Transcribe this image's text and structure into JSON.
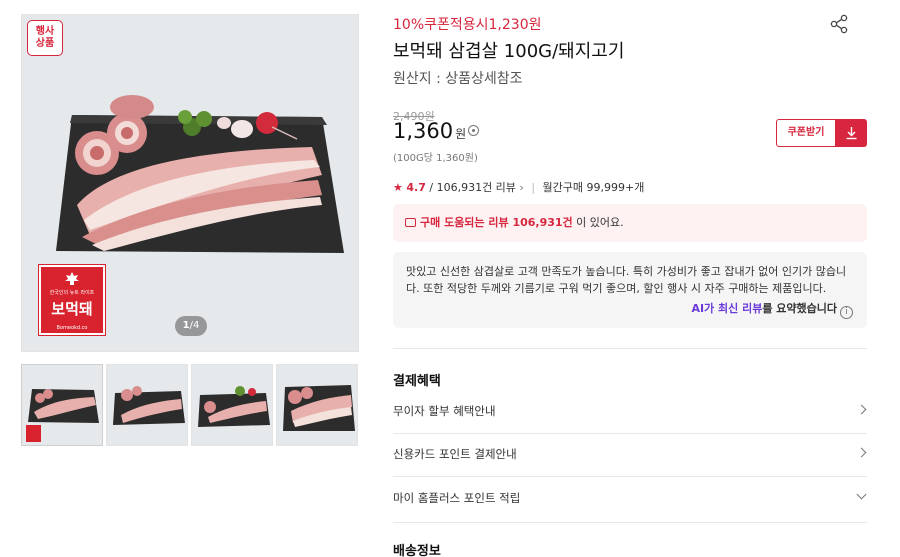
{
  "gallery": {
    "event_badge": [
      "행사",
      "상품"
    ],
    "logo": {
      "small_text": "한국인의 뉴트 라이프",
      "brand": "보먹돼",
      "url": "Bomeokd.co"
    },
    "pager": {
      "current": "1",
      "total": "/4"
    },
    "thumb_count": 4
  },
  "product": {
    "coupon_line": "10%쿠폰적용시1,230원",
    "title": "보먹돼 삼겹살 100G/돼지고기",
    "origin": "원산지 : 상품상세참조",
    "original_price": "2,490원",
    "price": "1,360",
    "price_unit": "원",
    "unit_price": "(100G당 1,360원)",
    "coupon_button": "쿠폰받기"
  },
  "reviews": {
    "star": "★",
    "score": "4.7",
    "count_text": "/ 106,931건 리뷰",
    "chevron": "›",
    "monthly": "월간구매 99,999+개",
    "banner_highlight": "구매 도움되는 리뷰 106,931건",
    "banner_tail": " 이 있어요.",
    "summary": "맛있고 신선한 삼겹살로 고객 만족도가 높습니다. 특히 가성비가 좋고 잡내가 없어 인기가 많습니다. 또한 적당한 두께와 기름기로 구워 먹기 좋으며, 할인 행사 시 자주 구매하는 제품입니다.",
    "summary_ai": "AI가 최신 리뷰",
    "summary_rest": "를 요약했습니다",
    "info_glyph": "i"
  },
  "payment": {
    "title": "결제혜택",
    "rows": [
      "무이자 할부 혜택안내",
      "신용카드 포인트 결제안내",
      "마이 홈플러스 포인트 적립"
    ]
  },
  "shipping": {
    "title": "배송정보"
  },
  "colors": {
    "accent": "#d7263d",
    "ai": "#6a3ad8"
  },
  "icons": [
    "share-icon",
    "download-icon",
    "chat-icon",
    "info-icon",
    "chevron-right-icon",
    "chevron-down-icon"
  ]
}
